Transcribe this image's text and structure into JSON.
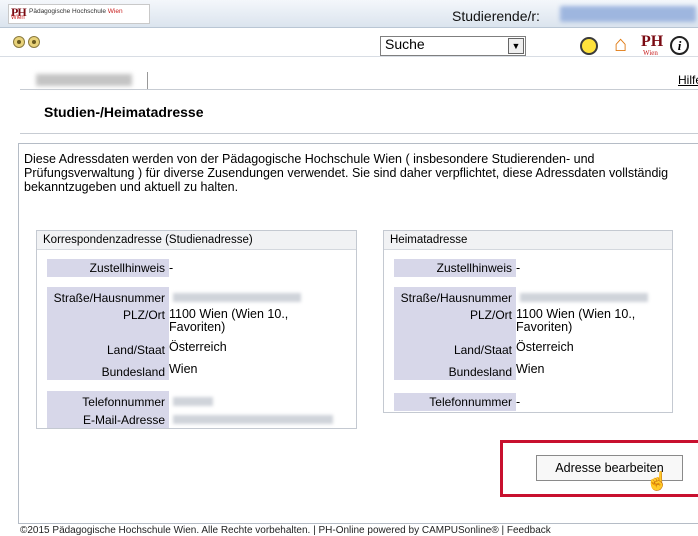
{
  "header": {
    "logo_text": "PH",
    "logo_subtext": "Wien",
    "institution": "Pädagogische Hochschule",
    "institution_accent": "Wien",
    "role_label": "Studierende/r:"
  },
  "toolbar": {
    "search_selected": "Suche"
  },
  "nav": {
    "help_link": "Hilfe"
  },
  "page": {
    "title": "Studien-/Heimatadresse",
    "intro": "Diese Adressdaten werden von der Pädagogische Hochschule Wien ( insbesondere Studierenden- und Prüfungsverwaltung ) für diverse Zusendungen verwendet. Sie sind daher verpflichtet, diese Adressdaten vollständig bekanntzugeben und aktuell zu halten."
  },
  "correspondence": {
    "title": "Korrespondenzadresse (Studienadresse)",
    "delivery_label": "Zustellhinweis",
    "delivery_value": "-",
    "street_label": "Straße/Hausnummer",
    "zip_label": "PLZ/Ort",
    "zip_value": "1100 Wien (Wien 10., Favoriten)",
    "country_label": "Land/Staat",
    "country_value": "Österreich",
    "state_label": "Bundesland",
    "state_value": "Wien",
    "phone_label": "Telefonnummer",
    "email_label": "E-Mail-Adresse"
  },
  "home": {
    "title": "Heimatadresse",
    "delivery_label": "Zustellhinweis",
    "delivery_value": "-",
    "street_label": "Straße/Hausnummer",
    "zip_label": "PLZ/Ort",
    "zip_value": "1100 Wien (Wien 10., Favoriten)",
    "country_label": "Land/Staat",
    "country_value": "Österreich",
    "state_label": "Bundesland",
    "state_value": "Wien",
    "phone_label": "Telefonnummer",
    "phone_value": "-"
  },
  "actions": {
    "edit_address": "Adresse bearbeiten"
  },
  "footer": {
    "text": "©2015 Pädagogische Hochschule Wien. Alle Rechte vorbehalten. | PH-Online powered by CAMPUSonline® | Feedback"
  },
  "icons": [
    "ph-logo-icon",
    "nav-circle-icon",
    "dropdown-arrow-icon",
    "sun-icon",
    "home-icon",
    "info-icon",
    "hand-cursor-icon"
  ],
  "colors": {
    "label_bg": "#d7d7e9",
    "highlight": "#c8102e",
    "brand": "#7a0a12"
  }
}
